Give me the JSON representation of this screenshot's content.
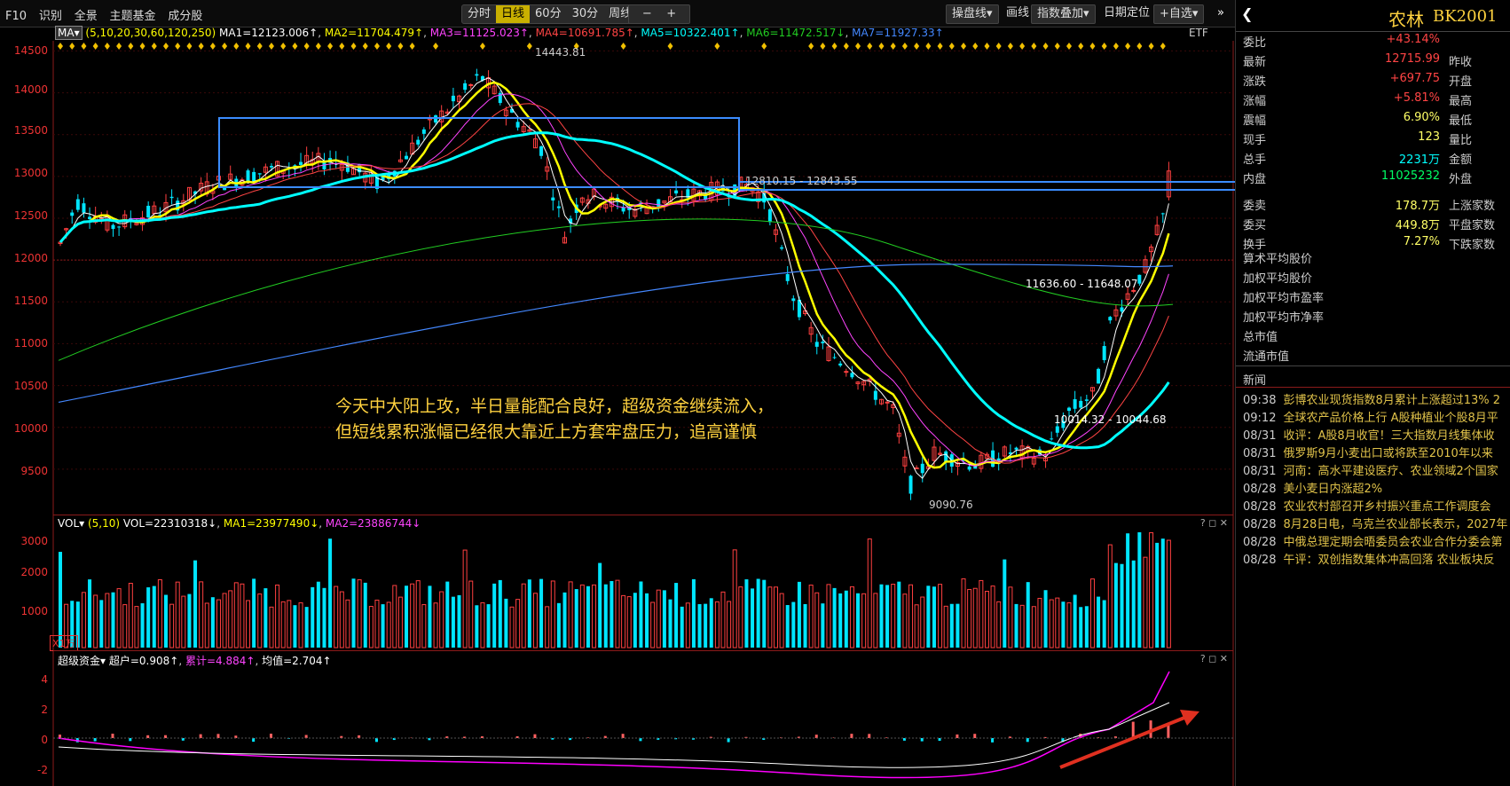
{
  "toolbar": {
    "left_items": [
      "F10",
      "识别",
      "全景",
      "主题基金",
      "成分股"
    ],
    "periods": [
      "分时",
      "日线",
      "60分",
      "30分",
      "周线▾"
    ],
    "active_period": "日线",
    "zoom_minus": "−",
    "zoom_plus": "+",
    "right_items": [
      "操盘线▾",
      "画线",
      "指数叠加▾",
      "日期定位",
      "+自选▾"
    ],
    "nav_prev": "◀",
    "nav_next": "▶"
  },
  "ma_legend": {
    "label": "MA▾",
    "params": "(5,10,20,30,60,120,250)",
    "items": [
      {
        "text": "MA1=12123.006↑",
        "color": "#ffffff"
      },
      {
        "text": "MA2=11704.479↑",
        "color": "#ffff00"
      },
      {
        "text": "MA3=11125.023↑",
        "color": "#ff44ff"
      },
      {
        "text": "MA4=10691.785↑",
        "color": "#ff4444"
      },
      {
        "text": "MA5=10322.401↑",
        "color": "#00ffff"
      },
      {
        "text": "MA6=11472.517↓",
        "color": "#22cc22"
      },
      {
        "text": "MA7=11927.33↑",
        "color": "#4488ff"
      }
    ],
    "etf": "ETF"
  },
  "price_axis": [
    "14500",
    "14000",
    "13500",
    "13000",
    "12500",
    "12000",
    "11500",
    "11000",
    "10500",
    "10000",
    "9500"
  ],
  "price_labels": {
    "high": "14443.81",
    "low": "9090.76",
    "range1": "12810.15 - 12843.55",
    "range2": "11636.60 - 11648.07",
    "range3": "10014.32 - 10044.68"
  },
  "annotation": {
    "line1": "今天中大阳上攻，半日量能配合良好，超级资金继续流入，",
    "line2": "但短线累积涨幅已经很大靠近上方套牢盘压力，追高谨慎"
  },
  "vol_legend": {
    "label": "VOL▾",
    "params": "(5,10)",
    "vol": "VOL=22310318↓",
    "ma1": "MA1=23977490↓",
    "ma2": "MA2=23886744↓",
    "unit": "X1万",
    "axis": [
      "3000",
      "2000",
      "1000"
    ]
  },
  "fund_legend": {
    "label": "超级资金▾",
    "super": "超户=0.908↑",
    "cum": "累计=4.884↑",
    "avg": "均值=2.704↑",
    "axis": [
      "4",
      "2",
      "0",
      "-2"
    ]
  },
  "pane_icons": "? ◻ ✕",
  "chart_data": {
    "type": "candlestick",
    "series": [
      {
        "name": "MA1",
        "color": "#ffffff"
      },
      {
        "name": "MA2",
        "color": "#ffff00"
      },
      {
        "name": "MA3",
        "color": "#ff44ff"
      },
      {
        "name": "MA4",
        "color": "#ff4444"
      },
      {
        "name": "MA5",
        "color": "#00ffff"
      },
      {
        "name": "MA6",
        "color": "#22cc22"
      },
      {
        "name": "MA7",
        "color": "#4488ff"
      }
    ],
    "ylim": [
      9000,
      14600
    ]
  },
  "quote": {
    "name": "农林",
    "code": "BK2001",
    "back": "❮",
    "rows": [
      {
        "l": "委比",
        "v": "+43.14%",
        "vc": "#ff4444",
        "r": ""
      },
      {
        "l": "最新",
        "v": "12715.99",
        "vc": "#ff4444",
        "r": "昨收"
      },
      {
        "l": "涨跌",
        "v": "+697.75",
        "vc": "#ff4444",
        "r": "开盘"
      },
      {
        "l": "涨幅",
        "v": "+5.81%",
        "vc": "#ff4444",
        "r": "最高"
      },
      {
        "l": "震幅",
        "v": "6.90%",
        "vc": "#ffff66",
        "r": "最低"
      },
      {
        "l": "现手",
        "v": "123",
        "vc": "#ffff66",
        "r": "量比"
      },
      {
        "l": "总手",
        "v": "2231万",
        "vc": "#00ffff",
        "r": "金额"
      },
      {
        "l": "内盘",
        "v": "11025232",
        "vc": "#00ff66",
        "r": "外盘"
      },
      {
        "l": "委卖",
        "v": "178.7万",
        "vc": "#ffff66",
        "r": "上涨家数"
      },
      {
        "l": "委买",
        "v": "449.8万",
        "vc": "#ffff66",
        "r": "平盘家数"
      },
      {
        "l": "换手",
        "v": "7.27%",
        "vc": "#ffff66",
        "r": "下跌家数"
      }
    ],
    "stats": [
      "算术平均股价",
      "加权平均股价",
      "加权平均市盈率",
      "加权平均市净率",
      "总市值",
      "流通市值"
    ]
  },
  "news": {
    "title": "新闻",
    "items": [
      {
        "t": "09:38",
        "h": "彭博农业现货指数8月累计上涨超过13% 2"
      },
      {
        "t": "09:12",
        "h": "全球农产品价格上行 A股种植业个股8月平"
      },
      {
        "t": "08/31",
        "h": "收评：A股8月收官！三大指数月线集体收"
      },
      {
        "t": "08/31",
        "h": "俄罗斯9月小麦出口或将跌至2010年以来"
      },
      {
        "t": "08/31",
        "h": "河南：高水平建设医疗、农业领域2个国家"
      },
      {
        "t": "08/28",
        "h": "美小麦日内涨超2%"
      },
      {
        "t": "08/28",
        "h": "农业农村部召开乡村振兴重点工作调度会"
      },
      {
        "t": "08/28",
        "h": "8月28日电，乌克兰农业部长表示，2027年"
      },
      {
        "t": "08/28",
        "h": "中俄总理定期会晤委员会农业合作分委会第"
      },
      {
        "t": "08/28",
        "h": "午评：双创指数集体冲高回落 农业板块反"
      }
    ]
  }
}
